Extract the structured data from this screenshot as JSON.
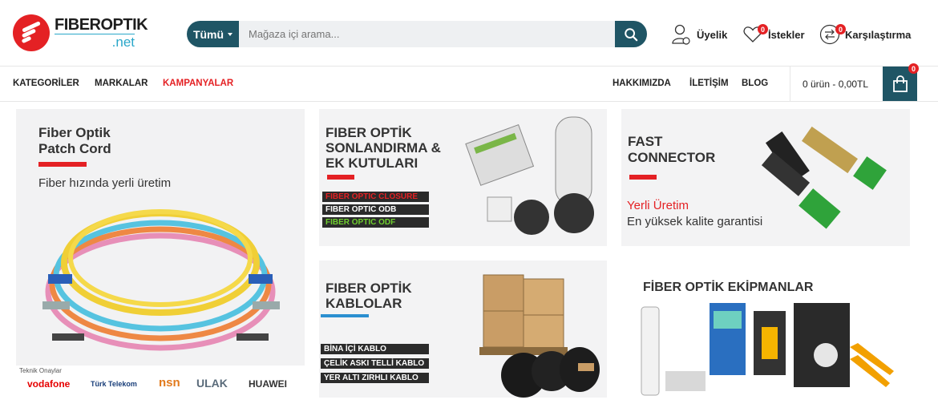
{
  "header": {
    "logo_main": "FIBEROPTIK",
    "logo_sub": ".net",
    "search_category": "Tümü",
    "search_placeholder": "Mağaza içi arama...",
    "account_label": "Üyelik",
    "wishlist_label": "İstekler",
    "wishlist_count": "0",
    "compare_label": "Karşılaştırma",
    "compare_count": "0"
  },
  "nav": {
    "left": [
      "KATEGORİLER",
      "MARKALAR",
      "KAMPANYALAR"
    ],
    "right": [
      "HAKKIMIZDA",
      "İLETİŞİM",
      "BLOG"
    ],
    "cart_text": "0 ürün - 0,00TL",
    "cart_count": "0"
  },
  "banners": {
    "patch": {
      "title1": "Fiber Optik",
      "title2": "Patch Cord",
      "subtitle": "Fiber hızında yerli üretim",
      "approvals": "Teknik Onaylar",
      "brands": [
        "vodafone",
        "Türk Telekom",
        "nsn",
        "ULAK",
        "HUAWEI"
      ]
    },
    "closure": {
      "title1": "FIBER OPTİK",
      "title2": "SONLANDIRMA &",
      "title3": "EK KUTULARI",
      "chips": [
        "FIBER OPTIC CLOSURE",
        "FIBER OPTIC ODB",
        "FIBER OPTIC ODF"
      ]
    },
    "fast": {
      "title1": "FAST",
      "title2": "CONNECTOR",
      "line1": "Yerli Üretim",
      "line2": "En yüksek kalite garantisi"
    },
    "cable": {
      "title1": "FIBER OPTİK",
      "title2": "KABLOLAR",
      "chips": [
        "BİNA İÇİ KABLO",
        "ÇELİK ASKI TELLİ KABLO",
        "YER ALTI ZIRHLI KABLO"
      ]
    },
    "tools": {
      "title": "FİBER OPTİK EKİPMANLAR"
    }
  },
  "colors": {
    "brand": "#1f5565",
    "accent": "#e42124",
    "sub": "#2aa7c9"
  }
}
